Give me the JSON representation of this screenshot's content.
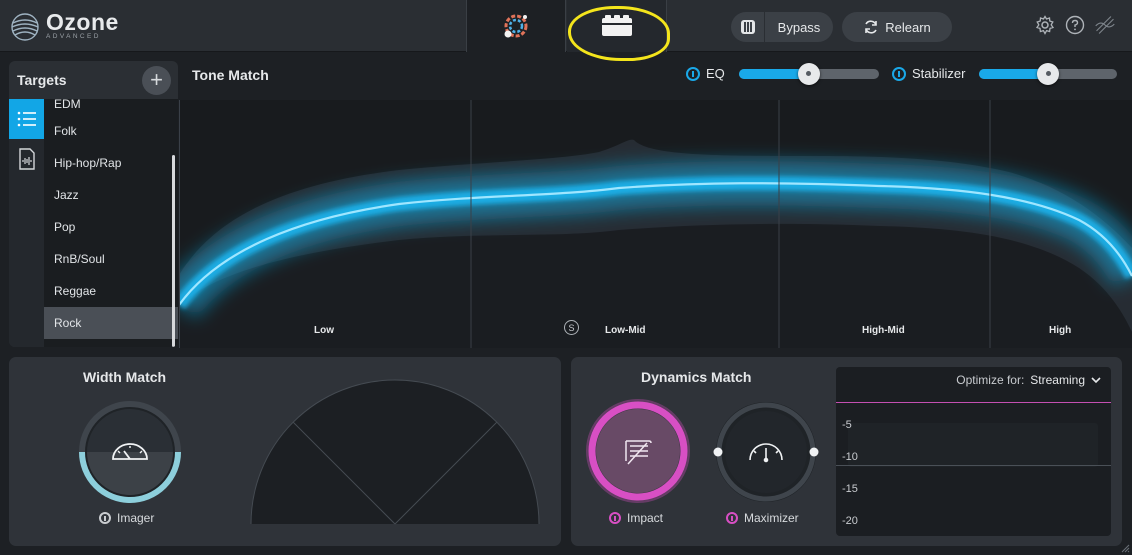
{
  "app": {
    "name": "Ozone",
    "edition": "ADVANCED"
  },
  "header": {
    "bypass_label": "Bypass",
    "relearn_label": "Relearn",
    "highlight_color": "#f4e51c"
  },
  "targets": {
    "title": "Targets",
    "items": [
      "EDM",
      "Folk",
      "Hip-hop/Rap",
      "Jazz",
      "Pop",
      "RnB/Soul",
      "Reggae",
      "Rock"
    ],
    "selected": "Rock"
  },
  "tone_match": {
    "title": "Tone Match",
    "eq_label": "EQ",
    "eq_level": 0.5,
    "stabilizer_label": "Stabilizer",
    "stabilizer_level": 0.5,
    "bands": [
      "Low",
      "Low-Mid",
      "High-Mid",
      "High"
    ],
    "solo_label": "S",
    "curve_color": "#19c3ff"
  },
  "width_match": {
    "title": "Width Match",
    "imager_label": "Imager"
  },
  "dynamics_match": {
    "title": "Dynamics Match",
    "impact_label": "Impact",
    "maximizer_label": "Maximizer",
    "optimize_label": "Optimize for:",
    "optimize_value": "Streaming",
    "db_ticks": [
      "-5",
      "-10",
      "-15",
      "-20"
    ],
    "accent_color": "#d84fc4"
  }
}
